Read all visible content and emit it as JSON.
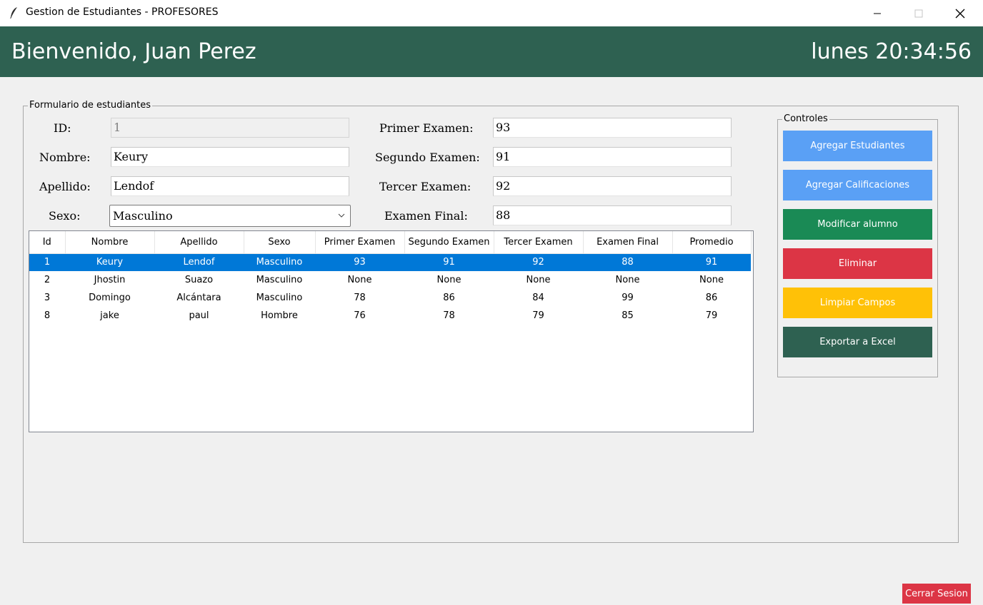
{
  "window": {
    "title": "Gestion de Estudiantes - PROFESORES",
    "icon": "feather-icon"
  },
  "header": {
    "welcome": "Bienvenido, Juan Perez",
    "clock": "lunes 20:34:56",
    "background": "#2e6151"
  },
  "form": {
    "legend": "Formulario de estudiantes",
    "id_label": "ID:",
    "id_value": "1",
    "nombre_label": "Nombre:",
    "nombre_value": "Keury",
    "apellido_label": "Apellido:",
    "apellido_value": "Lendof",
    "sexo_label": "Sexo:",
    "sexo_value": "Masculino",
    "primer_label": "Primer Examen:",
    "primer_value": "93",
    "segundo_label": "Segundo Examen:",
    "segundo_value": "91",
    "tercer_label": "Tercer Examen:",
    "tercer_value": "92",
    "final_label": "Examen Final:",
    "final_value": "88"
  },
  "table": {
    "columns": [
      "Id",
      "Nombre",
      "Apellido",
      "Sexo",
      "Primer Examen",
      "Segundo Examen",
      "Tercer Examen",
      "Examen Final",
      "Promedio"
    ],
    "rows": [
      [
        "1",
        "Keury",
        "Lendof",
        "Masculino",
        "93",
        "91",
        "92",
        "88",
        "91"
      ],
      [
        "2",
        "Jhostin",
        "Suazo",
        "Masculino",
        "None",
        "None",
        "None",
        "None",
        "None"
      ],
      [
        "3",
        "Domingo",
        "Alcántara",
        "Masculino",
        "78",
        "86",
        "84",
        "99",
        "86"
      ],
      [
        "8",
        "jake",
        "paul",
        "Hombre",
        "76",
        "78",
        "79",
        "85",
        "79"
      ]
    ],
    "selected_row": 0,
    "selection_color": "#0078d7"
  },
  "controls": {
    "legend": "Controles",
    "buttons": [
      {
        "label": "Agregar Estudiantes",
        "color": "#5aa0f5"
      },
      {
        "label": "Agregar Calificaciones",
        "color": "#5aa0f5"
      },
      {
        "label": "Modificar alumno",
        "color": "#1a8a55"
      },
      {
        "label": "Eliminar",
        "color": "#dc3545"
      },
      {
        "label": "Limpiar Campos",
        "color": "#ffc107"
      },
      {
        "label": "Exportar a Excel",
        "color": "#2e6151"
      }
    ]
  },
  "footer": {
    "logout_label": "Cerrar Sesion",
    "logout_color": "#dc3545"
  }
}
